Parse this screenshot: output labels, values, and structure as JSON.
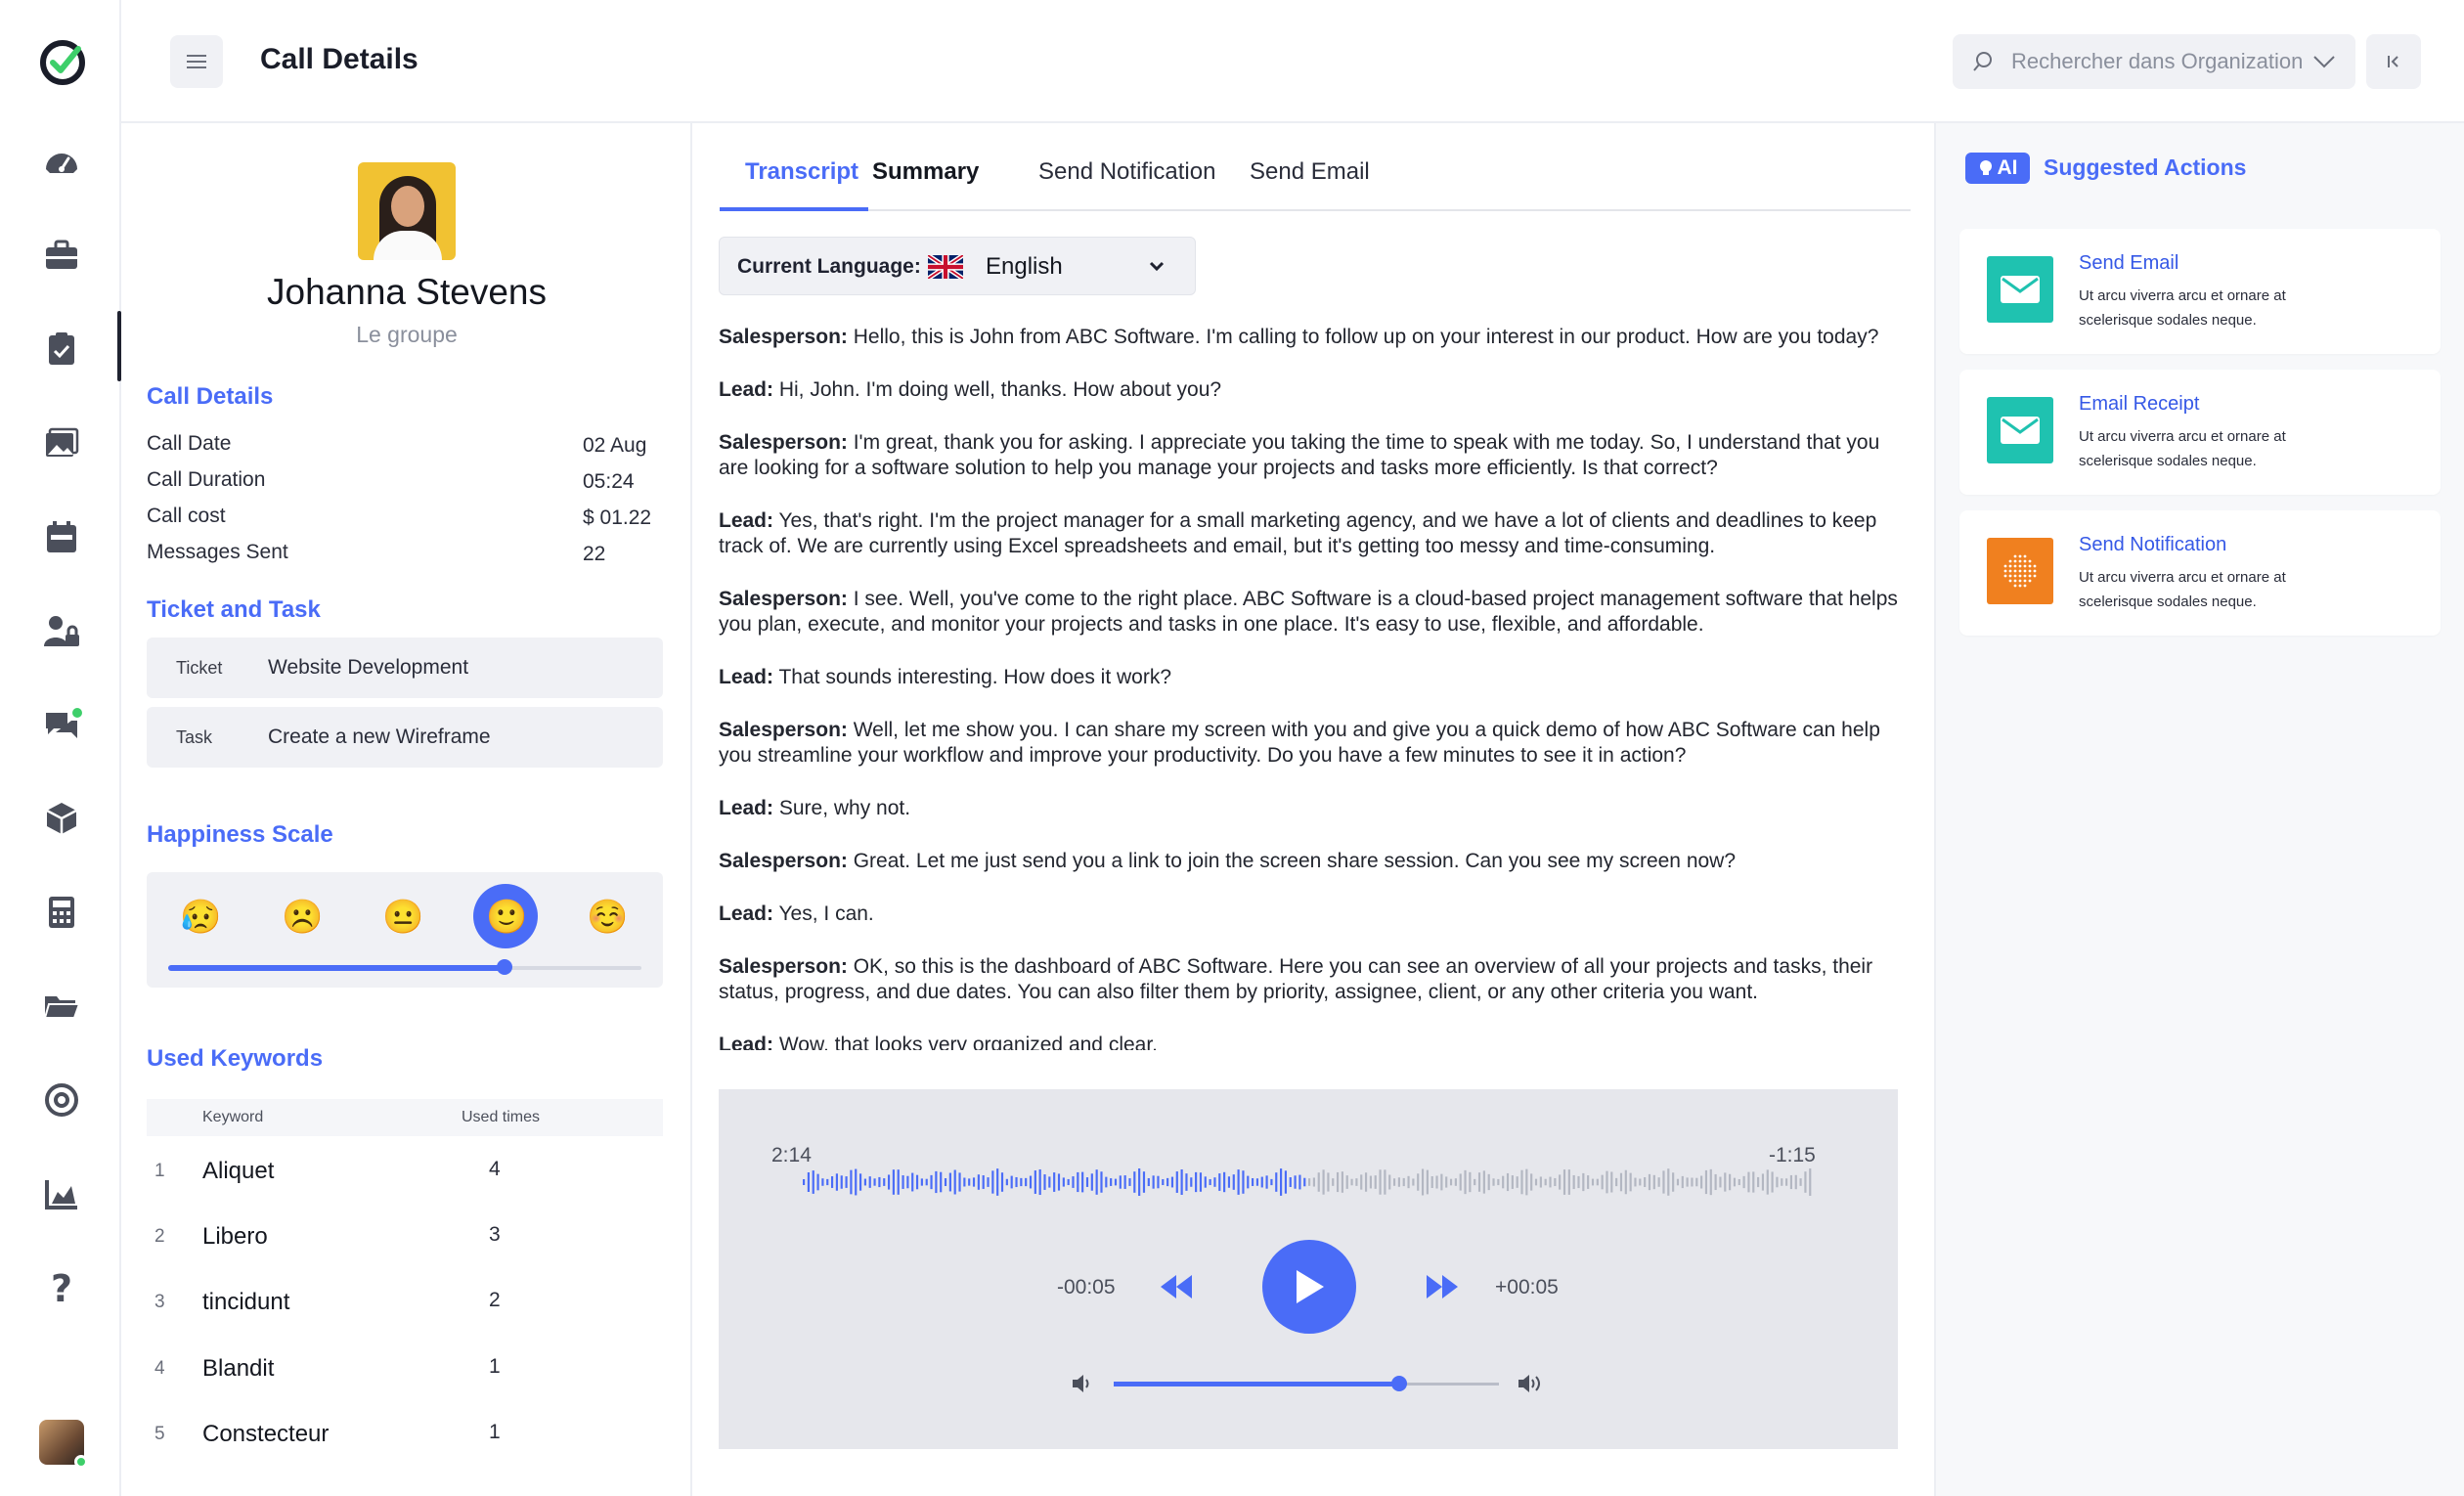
{
  "header": {
    "title": "Call Details",
    "search_placeholder": "Rechercher dans Organization"
  },
  "rail": {
    "icons": [
      "dashboard-icon",
      "briefcase-icon",
      "clipboard-check-icon",
      "gallery-icon",
      "calendar-icon",
      "user-lock-icon",
      "chat-icon",
      "box-icon",
      "calculator-icon",
      "folder-icon",
      "target-icon",
      "chart-icon",
      "help-icon"
    ]
  },
  "profile": {
    "name": "Johanna Stevens",
    "org": "Le groupe",
    "call_details_title": "Call Details",
    "details": [
      {
        "label": "Call Date",
        "value": "02 Aug"
      },
      {
        "label": "Call Duration",
        "value": "05:24"
      },
      {
        "label": "Call cost",
        "value": "$ 01.22"
      },
      {
        "label": "Messages Sent",
        "value": "22"
      }
    ],
    "ticket_title": "Ticket and Task",
    "ticket": {
      "label": "Ticket",
      "value": "Website Development"
    },
    "task": {
      "label": "Task",
      "value": "Create a new Wireframe"
    },
    "happiness_title": "Happiness Scale",
    "happiness": {
      "emojis": [
        "😥",
        "☹️",
        "😐",
        "🙂",
        "☺️"
      ],
      "selected_index": 3,
      "level": 0.71
    },
    "keywords_title": "Used Keywords",
    "keywords_headers": {
      "keyword": "Keyword",
      "used": "Used times"
    },
    "keywords": [
      {
        "n": "1",
        "word": "Aliquet",
        "count": "4"
      },
      {
        "n": "2",
        "word": "Libero",
        "count": "3"
      },
      {
        "n": "3",
        "word": "tincidunt",
        "count": "2"
      },
      {
        "n": "4",
        "word": "Blandit",
        "count": "1"
      },
      {
        "n": "5",
        "word": "Constecteur",
        "count": "1"
      }
    ]
  },
  "tabs": [
    "Transcript",
    "Summary",
    "Send Notification",
    "Send Email"
  ],
  "language": {
    "label": "Current Language:",
    "value": "English"
  },
  "transcript": [
    {
      "speaker": "Salesperson:",
      "text": " Hello, this is John from ABC Software. I'm calling to follow up on your interest in our product. How are you today?"
    },
    {
      "speaker": "Lead:",
      "text": " Hi, John. I'm doing well, thanks. How about you?"
    },
    {
      "speaker": "Salesperson:",
      "text": " I'm great, thank you for asking. I appreciate you taking the time to speak with me today. So, I understand that you are looking for a software solution to help you manage your projects and tasks more efficiently. Is that correct?"
    },
    {
      "speaker": "Lead:",
      "text": " Yes, that's right. I'm the project manager for a small marketing agency, and we have a lot of clients and deadlines to keep track of. We are currently using Excel spreadsheets and email, but it's getting too messy and time-consuming."
    },
    {
      "speaker": "Salesperson:",
      "text": " I see. Well, you've come to the right place. ABC Software is a cloud-based project management software that helps you plan, execute, and monitor your projects and tasks in one place. It's easy to use, flexible, and affordable."
    },
    {
      "speaker": "Lead:",
      "text": " That sounds interesting. How does it work?"
    },
    {
      "speaker": "Salesperson:",
      "text": " Well, let me show you. I can share my screen with you and give you a quick demo of how ABC Software can help you streamline your workflow and improve your productivity. Do you have a few minutes to see it in action?"
    },
    {
      "speaker": "Lead:",
      "text": " Sure, why not."
    },
    {
      "speaker": "Salesperson:",
      "text": " Great. Let me just send you a link to join the screen share session. Can you see my screen now?"
    },
    {
      "speaker": "Lead:",
      "text": " Yes, I can."
    },
    {
      "speaker": "Salesperson:",
      "text": " OK, so this is the dashboard of ABC Software. Here you can see an overview of all your projects and tasks, their status, progress, and due dates. You can also filter them by priority, assignee, client, or any other criteria you want."
    },
    {
      "speaker": "Lead:",
      "text": " Wow, that looks very organized and clear."
    }
  ],
  "player": {
    "elapsed": "2:14",
    "remaining": "-1:15",
    "progress": 0.5,
    "skip_back": "-00:05",
    "skip_forward": "+00:05",
    "volume": 0.74
  },
  "suggested": {
    "badge": "AI",
    "title": "Suggested Actions",
    "cards": [
      {
        "title": "Send Email",
        "desc": "Ut arcu viverra arcu et ornare at scelerisque sodales neque.",
        "icon": "mail-icon",
        "color": "#1fc2b0"
      },
      {
        "title": "Email Receipt",
        "desc": "Ut arcu viverra arcu et ornare at scelerisque sodales neque.",
        "icon": "mail-icon",
        "color": "#1fc2b0"
      },
      {
        "title": "Send Notification",
        "desc": "Ut arcu viverra arcu et ornare at scelerisque sodales neque.",
        "icon": "notification-icon",
        "color": "#f0801f"
      }
    ]
  },
  "colors": {
    "accent": "#4a6cf7",
    "teal": "#1fc2b0",
    "orange": "#f0801f",
    "online": "#3ecf6a"
  }
}
